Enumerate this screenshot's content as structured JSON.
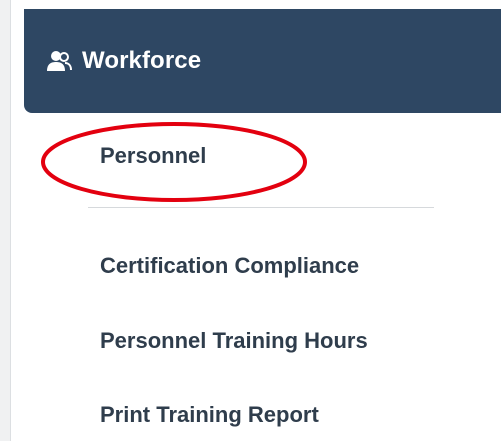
{
  "menu": {
    "header_title": "Workforce",
    "header_icon": "users-icon",
    "items": [
      {
        "label": "Personnel"
      },
      {
        "label": "Certification Compliance"
      },
      {
        "label": "Personnel Training Hours"
      },
      {
        "label": "Print Training Report"
      }
    ]
  },
  "annotation": {
    "highlight_color": "#e3000f"
  },
  "colors": {
    "header_bg": "#2e4763",
    "item_text": "#2f3d4c"
  }
}
